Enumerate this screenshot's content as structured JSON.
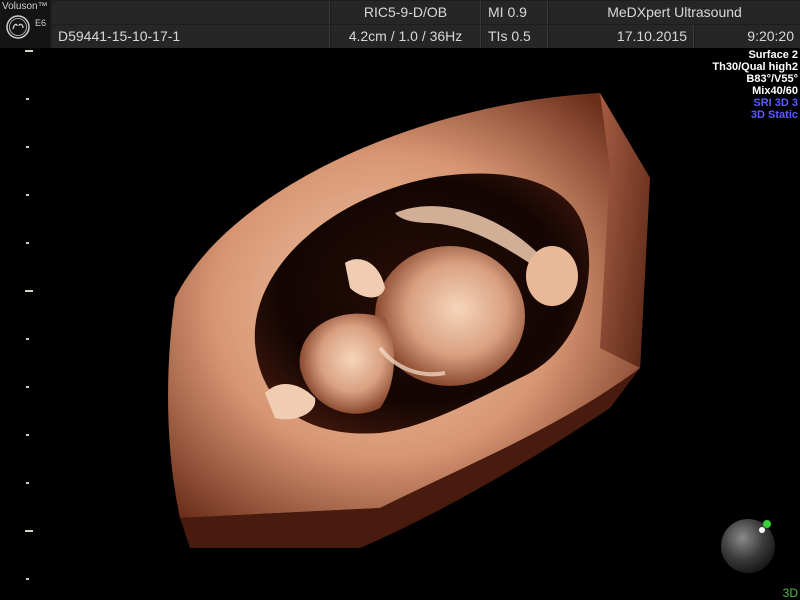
{
  "header": {
    "brand": "Voluson™",
    "model": "E6",
    "probe_preset": "RIC5-9-D/OB",
    "mi": "MI  0.9",
    "institution": "MeDXpert Ultrasound",
    "patient_id": "D59441-15-10-17-1",
    "depth_freq": "4.2cm / 1.0 / 36Hz",
    "tis": "TIs  0.5",
    "date": "17.10.2015",
    "time": "9:20:20"
  },
  "params": {
    "lines": [
      {
        "text": "Surface 2",
        "color": "#ffffff"
      },
      {
        "text": "Th30/Qual high2",
        "color": "#ffffff"
      },
      {
        "text": "B83°/V55°",
        "color": "#ffffff"
      },
      {
        "text": "Mix40/60",
        "color": "#ffffff"
      },
      {
        "text": "SRI 3D 3",
        "color": "#5b5bff"
      },
      {
        "text": "3D Static",
        "color": "#5b5bff"
      }
    ]
  },
  "corner_label": "3D",
  "icons": {
    "logo": "ge-logo-icon",
    "orientation": "orientation-ball-icon"
  }
}
